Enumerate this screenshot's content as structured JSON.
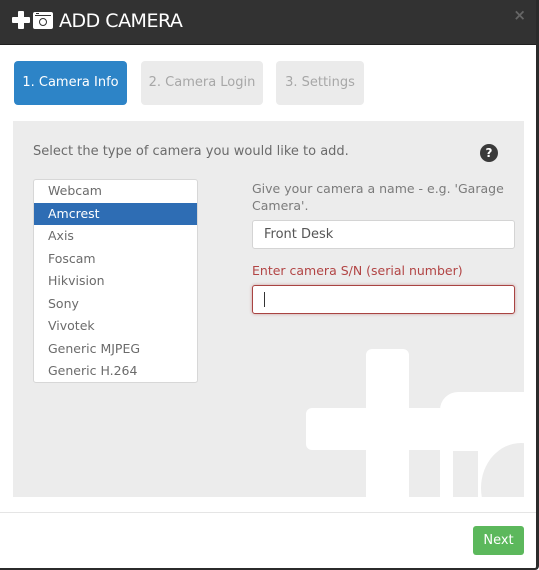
{
  "dialog": {
    "title": "ADD CAMERA",
    "icons": [
      "plus-icon",
      "camera-icon"
    ],
    "close_icon": "×"
  },
  "steps": [
    {
      "label": "1. Camera Info",
      "state": "active"
    },
    {
      "label": "2. Camera Login",
      "state": "inactive"
    },
    {
      "label": "3. Settings",
      "state": "inactive"
    }
  ],
  "panel": {
    "prompt": "Select the type of camera you would like to add.",
    "help_icon": "?",
    "camera_types": [
      "Webcam",
      "Amcrest",
      "Axis",
      "Foscam",
      "Hikvision",
      "Sony",
      "Vivotek",
      "Generic MJPEG",
      "Generic H.264"
    ],
    "selected_type": "Amcrest",
    "name_label": "Give your camera a name - e.g. 'Garage Camera'.",
    "name_value": "Front Desk",
    "sn_label": "Enter camera S/N (serial number)",
    "sn_value": ""
  },
  "footer": {
    "next_label": "Next"
  },
  "colors": {
    "header_bg": "#323232",
    "active_step": "#2d84c7",
    "selected_item": "#2e6db4",
    "error": "#a94442",
    "next_button": "#5cb85c"
  }
}
